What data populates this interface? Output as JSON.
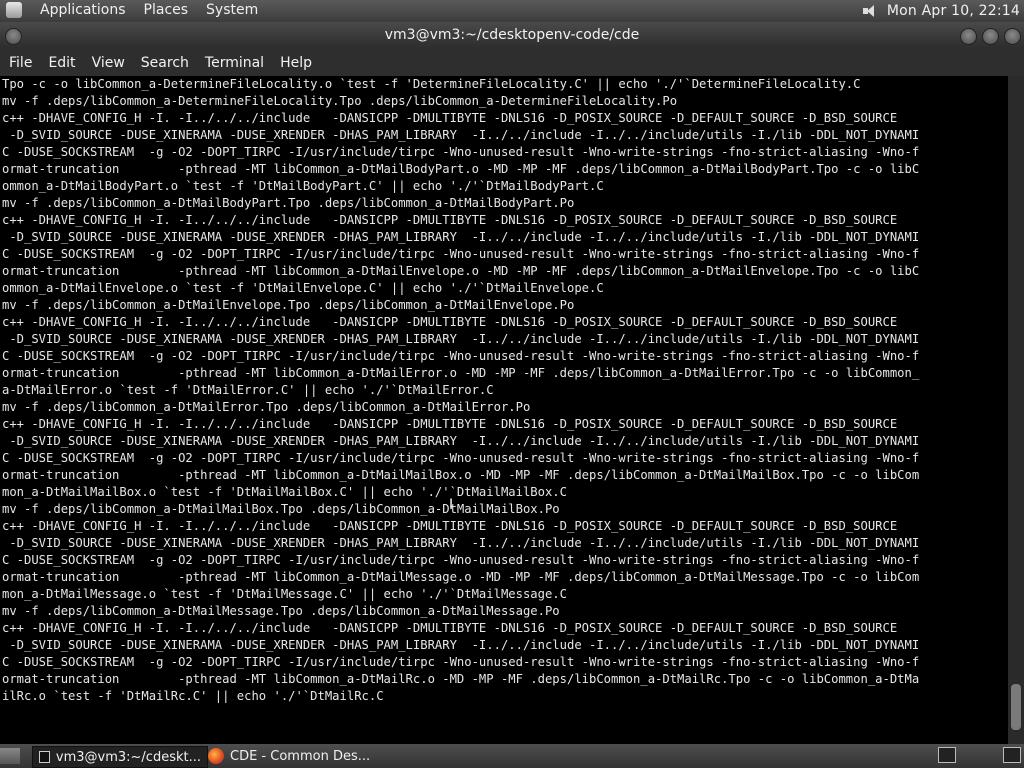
{
  "top_panel": {
    "menus": [
      "Applications",
      "Places",
      "System"
    ],
    "clock": "Mon Apr 10, 22:14",
    "volume_icon": "volume-icon"
  },
  "window": {
    "title": "vm3@vm3:~/cdesktopenv-code/cde"
  },
  "menubar": {
    "items": [
      "File",
      "Edit",
      "View",
      "Search",
      "Terminal",
      "Help"
    ]
  },
  "terminal": {
    "lines": [
      "Tpo -c -o libCommon_a-DetermineFileLocality.o `test -f 'DetermineFileLocality.C' || echo './'`DetermineFileLocality.C",
      "mv -f .deps/libCommon_a-DetermineFileLocality.Tpo .deps/libCommon_a-DetermineFileLocality.Po",
      "c++ -DHAVE_CONFIG_H -I. -I../../../include   -DANSICPP -DMULTIBYTE -DNLS16 -D_POSIX_SOURCE -D_DEFAULT_SOURCE -D_BSD_SOURCE",
      " -D_SVID_SOURCE -DUSE_XINERAMA -DUSE_XRENDER -DHAS_PAM_LIBRARY  -I../../include -I../../include/utils -I./lib -DDL_NOT_DYNAMI",
      "C -DUSE_SOCKSTREAM  -g -O2 -DOPT_TIRPC -I/usr/include/tirpc -Wno-unused-result -Wno-write-strings -fno-strict-aliasing -Wno-f",
      "ormat-truncation        -pthread -MT libCommon_a-DtMailBodyPart.o -MD -MP -MF .deps/libCommon_a-DtMailBodyPart.Tpo -c -o libC",
      "ommon_a-DtMailBodyPart.o `test -f 'DtMailBodyPart.C' || echo './'`DtMailBodyPart.C",
      "mv -f .deps/libCommon_a-DtMailBodyPart.Tpo .deps/libCommon_a-DtMailBodyPart.Po",
      "c++ -DHAVE_CONFIG_H -I. -I../../../include   -DANSICPP -DMULTIBYTE -DNLS16 -D_POSIX_SOURCE -D_DEFAULT_SOURCE -D_BSD_SOURCE",
      " -D_SVID_SOURCE -DUSE_XINERAMA -DUSE_XRENDER -DHAS_PAM_LIBRARY  -I../../include -I../../include/utils -I./lib -DDL_NOT_DYNAMI",
      "C -DUSE_SOCKSTREAM  -g -O2 -DOPT_TIRPC -I/usr/include/tirpc -Wno-unused-result -Wno-write-strings -fno-strict-aliasing -Wno-f",
      "ormat-truncation        -pthread -MT libCommon_a-DtMailEnvelope.o -MD -MP -MF .deps/libCommon_a-DtMailEnvelope.Tpo -c -o libC",
      "ommon_a-DtMailEnvelope.o `test -f 'DtMailEnvelope.C' || echo './'`DtMailEnvelope.C",
      "mv -f .deps/libCommon_a-DtMailEnvelope.Tpo .deps/libCommon_a-DtMailEnvelope.Po",
      "c++ -DHAVE_CONFIG_H -I. -I../../../include   -DANSICPP -DMULTIBYTE -DNLS16 -D_POSIX_SOURCE -D_DEFAULT_SOURCE -D_BSD_SOURCE",
      " -D_SVID_SOURCE -DUSE_XINERAMA -DUSE_XRENDER -DHAS_PAM_LIBRARY  -I../../include -I../../include/utils -I./lib -DDL_NOT_DYNAMI",
      "C -DUSE_SOCKSTREAM  -g -O2 -DOPT_TIRPC -I/usr/include/tirpc -Wno-unused-result -Wno-write-strings -fno-strict-aliasing -Wno-f",
      "ormat-truncation        -pthread -MT libCommon_a-DtMailError.o -MD -MP -MF .deps/libCommon_a-DtMailError.Tpo -c -o libCommon_",
      "a-DtMailError.o `test -f 'DtMailError.C' || echo './'`DtMailError.C",
      "mv -f .deps/libCommon_a-DtMailError.Tpo .deps/libCommon_a-DtMailError.Po",
      "c++ -DHAVE_CONFIG_H -I. -I../../../include   -DANSICPP -DMULTIBYTE -DNLS16 -D_POSIX_SOURCE -D_DEFAULT_SOURCE -D_BSD_SOURCE",
      " -D_SVID_SOURCE -DUSE_XINERAMA -DUSE_XRENDER -DHAS_PAM_LIBRARY  -I../../include -I../../include/utils -I./lib -DDL_NOT_DYNAMI",
      "C -DUSE_SOCKSTREAM  -g -O2 -DOPT_TIRPC -I/usr/include/tirpc -Wno-unused-result -Wno-write-strings -fno-strict-aliasing -Wno-f",
      "ormat-truncation        -pthread -MT libCommon_a-DtMailMailBox.o -MD -MP -MF .deps/libCommon_a-DtMailMailBox.Tpo -c -o libCom",
      "mon_a-DtMailMailBox.o `test -f 'DtMailMailBox.C' || echo './'`DtMailMailBox.C",
      "mv -f .deps/libCommon_a-DtMailMailBox.Tpo .deps/libCommon_a-DtMailMailBox.Po",
      "c++ -DHAVE_CONFIG_H -I. -I../../../include   -DANSICPP -DMULTIBYTE -DNLS16 -D_POSIX_SOURCE -D_DEFAULT_SOURCE -D_BSD_SOURCE",
      " -D_SVID_SOURCE -DUSE_XINERAMA -DUSE_XRENDER -DHAS_PAM_LIBRARY  -I../../include -I../../include/utils -I./lib -DDL_NOT_DYNAMI",
      "C -DUSE_SOCKSTREAM  -g -O2 -DOPT_TIRPC -I/usr/include/tirpc -Wno-unused-result -Wno-write-strings -fno-strict-aliasing -Wno-f",
      "ormat-truncation        -pthread -MT libCommon_a-DtMailMessage.o -MD -MP -MF .deps/libCommon_a-DtMailMessage.Tpo -c -o libCom",
      "mon_a-DtMailMessage.o `test -f 'DtMailMessage.C' || echo './'`DtMailMessage.C",
      "mv -f .deps/libCommon_a-DtMailMessage.Tpo .deps/libCommon_a-DtMailMessage.Po",
      "c++ -DHAVE_CONFIG_H -I. -I../../../include   -DANSICPP -DMULTIBYTE -DNLS16 -D_POSIX_SOURCE -D_DEFAULT_SOURCE -D_BSD_SOURCE",
      " -D_SVID_SOURCE -DUSE_XINERAMA -DUSE_XRENDER -DHAS_PAM_LIBRARY  -I../../include -I../../include/utils -I./lib -DDL_NOT_DYNAMI",
      "C -DUSE_SOCKSTREAM  -g -O2 -DOPT_TIRPC -I/usr/include/tirpc -Wno-unused-result -Wno-write-strings -fno-strict-aliasing -Wno-f",
      "ormat-truncation        -pthread -MT libCommon_a-DtMailRc.o -MD -MP -MF .deps/libCommon_a-DtMailRc.Tpo -c -o libCommon_a-DtMa",
      "ilRc.o `test -f 'DtMailRc.C' || echo './'`DtMailRc.C"
    ]
  },
  "taskbar": {
    "tasks": [
      {
        "label": "vm3@vm3:~/cdeskt...",
        "icon": "terminal-icon",
        "active": true
      },
      {
        "label": "CDE - Common Des...",
        "icon": "firefox-icon",
        "active": false
      }
    ]
  },
  "colors": {
    "terminal_bg": "#000000",
    "terminal_fg": "#e6e6e6",
    "panel_bg": "#3c3c3c"
  }
}
